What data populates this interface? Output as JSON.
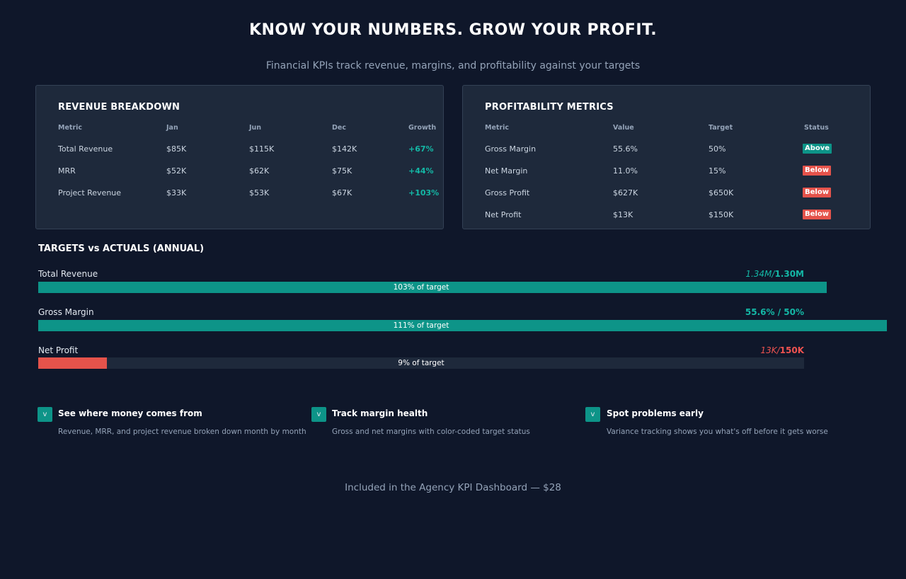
{
  "hero": {
    "title": "KNOW YOUR NUMBERS. GROW YOUR PROFIT.",
    "subtitle": "Financial KPIs track revenue, margins, and profitability against your targets"
  },
  "revenue": {
    "title": "REVENUE BREAKDOWN",
    "headers": [
      "Metric",
      "Jan",
      "Jun",
      "Dec",
      "Growth"
    ],
    "rows": [
      [
        "Total Revenue",
        "$85K",
        "$115K",
        "$142K",
        "+67%"
      ],
      [
        "MRR",
        "$52K",
        "$62K",
        "$75K",
        "+44%"
      ],
      [
        "Project Revenue",
        "$33K",
        "$53K",
        "$67K",
        "+103%"
      ]
    ]
  },
  "profitability": {
    "title": "PROFITABILITY METRICS",
    "headers": [
      "Metric",
      "Value",
      "Target",
      "Status"
    ],
    "rows": [
      [
        "Gross Margin",
        "55.6%",
        "50%",
        "Above"
      ],
      [
        "Net Margin",
        "11.0%",
        "15%",
        "Below"
      ],
      [
        "Gross Profit",
        "$627K",
        "$650K",
        "Below"
      ],
      [
        "Net Profit",
        "$13K",
        "$150K",
        "Below"
      ]
    ]
  },
  "targets": {
    "title": "TARGETS vs ACTUALS (ANNUAL)",
    "bars": [
      {
        "label": "Total Revenue",
        "value_actual": "1.34M/",
        "value_target": "1.30M",
        "text": "103% of target",
        "percent": 103,
        "color": "#0d9488",
        "value_color": "#14b8a6"
      },
      {
        "label": "Gross Margin",
        "value_actual": "55.6% / ",
        "value_target": "50%",
        "text": "111% of target",
        "percent": 111,
        "color": "#0d9488",
        "value_color": "#14b8a6"
      },
      {
        "label": "Net Profit",
        "value_actual": "13K/",
        "value_target": "150K",
        "text": "9% of target",
        "percent": 9,
        "color": "#e5534b",
        "value_color": "#ef5350"
      }
    ]
  },
  "features": [
    {
      "check": "v",
      "title": "See where money comes from",
      "desc": "Revenue, MRR, and project revenue broken down month by month"
    },
    {
      "check": "v",
      "title": "Track margin health",
      "desc": "Gross and net margins with color-coded target status"
    },
    {
      "check": "v",
      "title": "Spot problems early",
      "desc": "Variance tracking shows you what's off before it gets worse"
    }
  ],
  "footer": "Included in the Agency KPI Dashboard  —  $28",
  "colors": {
    "background": "#0f172a",
    "card": "#1e293b",
    "accent": "#0d9488",
    "above": "#0d9488",
    "below": "#e5534b"
  }
}
